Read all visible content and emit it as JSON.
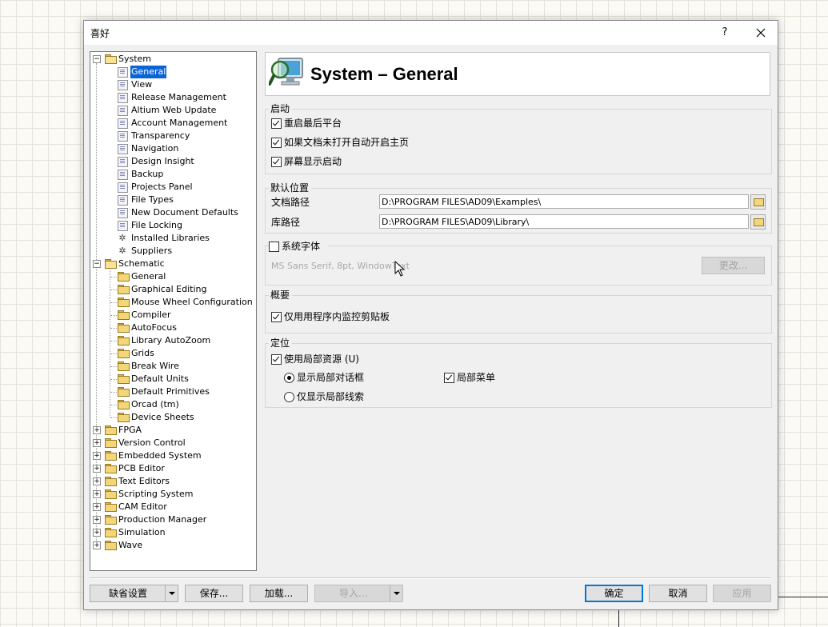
{
  "dialog": {
    "title": "喜好",
    "help": "?",
    "close": "close"
  },
  "tree": [
    {
      "label": "System",
      "depth": 0,
      "expander": "minus",
      "icon": "folder-open"
    },
    {
      "label": "General",
      "depth": 1,
      "icon": "page",
      "selected": true
    },
    {
      "label": "View",
      "depth": 1,
      "icon": "page"
    },
    {
      "label": "Release Management",
      "depth": 1,
      "icon": "page"
    },
    {
      "label": "Altium Web Update",
      "depth": 1,
      "icon": "page"
    },
    {
      "label": "Account Management",
      "depth": 1,
      "icon": "page"
    },
    {
      "label": "Transparency",
      "depth": 1,
      "icon": "page"
    },
    {
      "label": "Navigation",
      "depth": 1,
      "icon": "page"
    },
    {
      "label": "Design Insight",
      "depth": 1,
      "icon": "page"
    },
    {
      "label": "Backup",
      "depth": 1,
      "icon": "page"
    },
    {
      "label": "Projects Panel",
      "depth": 1,
      "icon": "page"
    },
    {
      "label": "File Types",
      "depth": 1,
      "icon": "page"
    },
    {
      "label": "New Document Defaults",
      "depth": 1,
      "icon": "page"
    },
    {
      "label": "File Locking",
      "depth": 1,
      "icon": "page"
    },
    {
      "label": "Installed Libraries",
      "depth": 1,
      "icon": "gear"
    },
    {
      "label": "Suppliers",
      "depth": 1,
      "icon": "gear"
    },
    {
      "label": "Schematic",
      "depth": 0,
      "expander": "minus",
      "icon": "folder-open"
    },
    {
      "label": "General",
      "depth": 1,
      "icon": "folder"
    },
    {
      "label": "Graphical Editing",
      "depth": 1,
      "icon": "folder"
    },
    {
      "label": "Mouse Wheel Configuration",
      "depth": 1,
      "icon": "folder"
    },
    {
      "label": "Compiler",
      "depth": 1,
      "icon": "folder"
    },
    {
      "label": "AutoFocus",
      "depth": 1,
      "icon": "folder"
    },
    {
      "label": "Library AutoZoom",
      "depth": 1,
      "icon": "folder"
    },
    {
      "label": "Grids",
      "depth": 1,
      "icon": "folder"
    },
    {
      "label": "Break Wire",
      "depth": 1,
      "icon": "folder"
    },
    {
      "label": "Default Units",
      "depth": 1,
      "icon": "folder"
    },
    {
      "label": "Default Primitives",
      "depth": 1,
      "icon": "folder"
    },
    {
      "label": "Orcad (tm)",
      "depth": 1,
      "icon": "folder"
    },
    {
      "label": "Device Sheets",
      "depth": 1,
      "icon": "folder"
    },
    {
      "label": "FPGA",
      "depth": 0,
      "expander": "plus",
      "icon": "folder"
    },
    {
      "label": "Version Control",
      "depth": 0,
      "expander": "plus",
      "icon": "folder"
    },
    {
      "label": "Embedded System",
      "depth": 0,
      "expander": "plus",
      "icon": "folder"
    },
    {
      "label": "PCB Editor",
      "depth": 0,
      "expander": "plus",
      "icon": "folder"
    },
    {
      "label": "Text Editors",
      "depth": 0,
      "expander": "plus",
      "icon": "folder"
    },
    {
      "label": "Scripting System",
      "depth": 0,
      "expander": "plus",
      "icon": "folder"
    },
    {
      "label": "CAM Editor",
      "depth": 0,
      "expander": "plus",
      "icon": "folder"
    },
    {
      "label": "Production Manager",
      "depth": 0,
      "expander": "plus",
      "icon": "folder"
    },
    {
      "label": "Simulation",
      "depth": 0,
      "expander": "plus",
      "icon": "folder"
    },
    {
      "label": "Wave",
      "depth": 0,
      "expander": "plus",
      "icon": "folder"
    }
  ],
  "header": {
    "title": "System – General",
    "icon": "monitor-magnifier-icon"
  },
  "startup": {
    "title": "启动",
    "reopen_last": {
      "label": "重启最后平台",
      "checked": true
    },
    "open_home": {
      "label": "如果文档未打开自动开启主页",
      "checked": true
    },
    "splash": {
      "label": "屏幕显示启动",
      "checked": true
    }
  },
  "default_locations": {
    "title": "默认位置",
    "doc_label": "文档路径",
    "doc_path": "D:\\PROGRAM FILES\\AD09\\Examples\\",
    "lib_label": "库路径",
    "lib_path": "D:\\PROGRAM FILES\\AD09\\Library\\"
  },
  "system_font": {
    "label": "系统字体",
    "checked": false,
    "font_desc": "MS Sans Serif, 8pt, WindowText",
    "change_button": "更改..."
  },
  "general": {
    "title": "概要",
    "clipboard": {
      "label": "仅用用程序内监控剪贴板",
      "checked": true
    }
  },
  "localization": {
    "title": "定位",
    "use_local": {
      "label": "使用局部资源 (U)",
      "checked": true
    },
    "radio_dialogs": {
      "label": "显示局部对话框",
      "checked": true
    },
    "radio_hints": {
      "label": "仅显示局部线索",
      "checked": false
    },
    "local_menus": {
      "label": "局部菜单",
      "checked": true
    }
  },
  "buttons": {
    "defaults": "缺省设置",
    "save": "保存...",
    "load": "加载...",
    "import": "导入...",
    "ok": "确定",
    "cancel": "取消",
    "apply": "应用"
  }
}
